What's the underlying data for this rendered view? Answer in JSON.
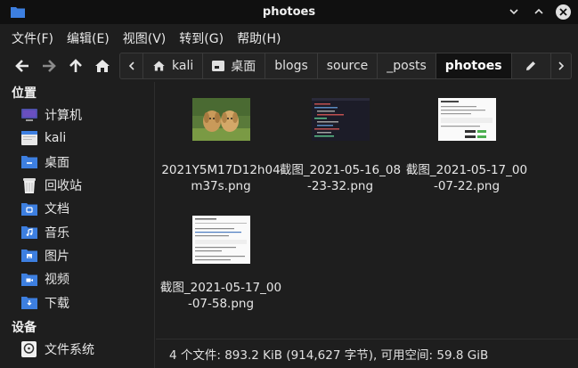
{
  "window": {
    "title": "photoes"
  },
  "menu": [
    "文件(F)",
    "编辑(E)",
    "视图(V)",
    "转到(G)",
    "帮助(H)"
  ],
  "pathbar": {
    "crumbs": [
      "kali",
      "桌面",
      "blogs",
      "source",
      "_posts",
      "photoes"
    ]
  },
  "sidebar": {
    "places_header": "位置",
    "places": [
      {
        "label": "计算机",
        "icon": "computer-icon"
      },
      {
        "label": "kali",
        "icon": "home-folder-icon"
      },
      {
        "label": "桌面",
        "icon": "desktop-folder-icon"
      },
      {
        "label": "回收站",
        "icon": "trash-icon"
      },
      {
        "label": "文档",
        "icon": "documents-folder-icon"
      },
      {
        "label": "音乐",
        "icon": "music-folder-icon"
      },
      {
        "label": "图片",
        "icon": "pictures-folder-icon"
      },
      {
        "label": "视频",
        "icon": "videos-folder-icon"
      },
      {
        "label": "下载",
        "icon": "downloads-folder-icon"
      }
    ],
    "devices_header": "设备",
    "devices": [
      {
        "label": "文件系统",
        "icon": "filesystem-icon"
      }
    ]
  },
  "files": [
    {
      "name": "2021Y5M17D12h04m37s.png",
      "thumb": "dogs-photo"
    },
    {
      "name": "截图_2021-05-16_08-23-32.png",
      "thumb": "code-screenshot"
    },
    {
      "name": "截图_2021-05-17_00-07-22.png",
      "thumb": "doc-screenshot"
    },
    {
      "name": "截图_2021-05-17_00-07-58.png",
      "thumb": "doc-screenshot"
    }
  ],
  "status": "4 个文件: 893.2 KiB (914,627 字节), 可用空间: 59.8 GiB",
  "colors": {
    "folder": "#3d7fe0",
    "background": "#1e1e1e",
    "titlebar": "#101010"
  }
}
